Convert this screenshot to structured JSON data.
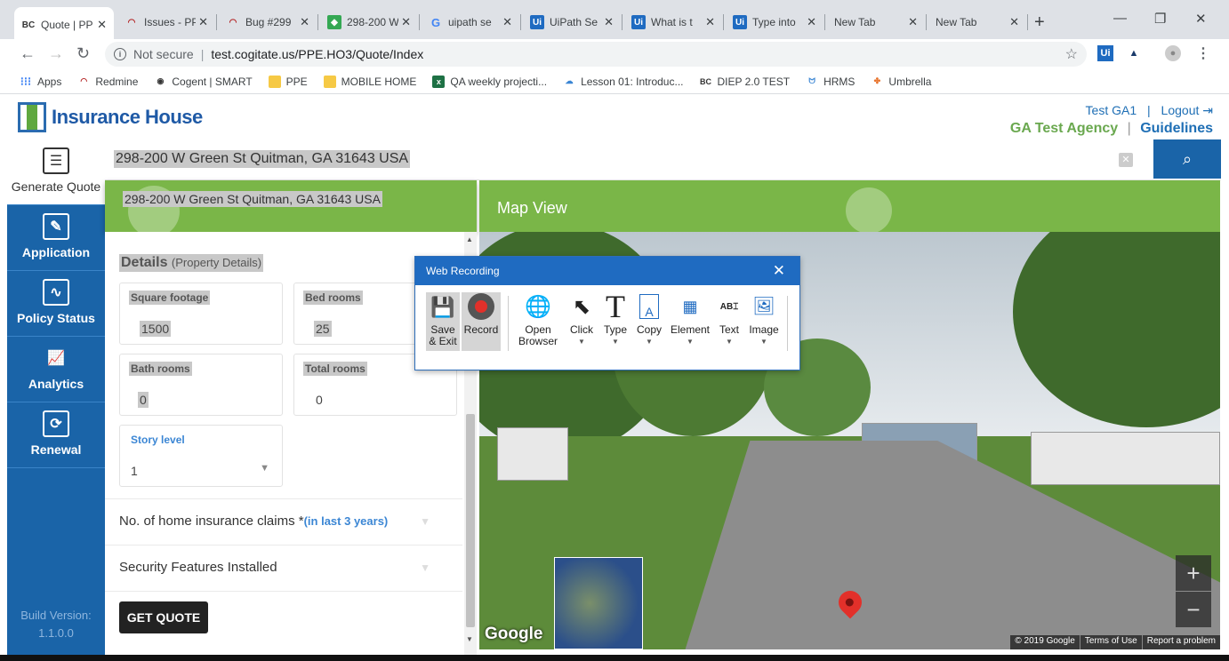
{
  "browser": {
    "tabs": [
      {
        "title": "Quote | PPE",
        "icon": "bc-icon"
      },
      {
        "title": "Issues - PPE",
        "icon": "redmine-icon"
      },
      {
        "title": "Bug #299",
        "icon": "redmine-icon"
      },
      {
        "title": "298-200 W",
        "icon": "maps-icon"
      },
      {
        "title": "uipath se",
        "icon": "google-icon"
      },
      {
        "title": "UiPath Se",
        "icon": "uipath-icon"
      },
      {
        "title": "What is t",
        "icon": "uipath-icon"
      },
      {
        "title": "Type into",
        "icon": "uipath-icon"
      },
      {
        "title": "New Tab",
        "icon": ""
      },
      {
        "title": "New Tab",
        "icon": ""
      }
    ],
    "not_secure": "Not secure",
    "url": "test.cogitate.us/PPE.HO3/Quote/Index",
    "bookmarks": [
      "Apps",
      "Redmine",
      "Cogent | SMART",
      "PPE",
      "MOBILE HOME",
      "QA weekly projecti...",
      "Lesson 01: Introduc...",
      "DIEP 2.0 TEST",
      "HRMS",
      "Umbrella"
    ]
  },
  "header": {
    "brand": "Insurance House",
    "user": "Test GA1",
    "logout": "Logout",
    "agency": "GA Test Agency",
    "guidelines": "Guidelines"
  },
  "sidebar": {
    "items": [
      {
        "label": "Generate Quote",
        "icon": "document-icon"
      },
      {
        "label": "Application",
        "icon": "edit-icon"
      },
      {
        "label": "Policy Status",
        "icon": "pulse-icon"
      },
      {
        "label": "Analytics",
        "icon": "chart-icon"
      },
      {
        "label": "Renewal",
        "icon": "renewal-icon"
      }
    ],
    "build_label": "Build Version:",
    "build_value": "1.1.0.0"
  },
  "search": {
    "value": "298-200 W Green St Quitman, GA 31643 USA"
  },
  "left_header": {
    "address": "298-200 W Green St Quitman, GA 31643 USA"
  },
  "map_header": {
    "title": "Map View"
  },
  "details": {
    "title": "Details",
    "subtitle": "(Property Details)",
    "fields": [
      {
        "label": "Square footage",
        "value": "1500"
      },
      {
        "label": "Bed rooms",
        "value": "25"
      },
      {
        "label": "Bath rooms",
        "value": "0"
      },
      {
        "label": "Total rooms",
        "value": "0"
      },
      {
        "label": "Story level",
        "value": "1"
      }
    ]
  },
  "accordions": {
    "claims": "No. of home insurance claims *",
    "claims_hint": "(in last 3 years)",
    "security": "Security Features Installed"
  },
  "get_quote": "GET QUOTE",
  "map": {
    "google": "Google",
    "footer": [
      "© 2019 Google",
      "Terms of Use",
      "Report a problem"
    ],
    "zoom_in": "+",
    "zoom_out": "−"
  },
  "recorder": {
    "title": "Web Recording",
    "buttons": [
      {
        "label": "Save\n& Exit",
        "icon": "save-icon"
      },
      {
        "label": "Record",
        "icon": "record-icon"
      },
      {
        "label": "Open\nBrowser",
        "icon": "globe-icon"
      },
      {
        "label": "Click",
        "icon": "cursor-icon"
      },
      {
        "label": "Type",
        "icon": "type-icon"
      },
      {
        "label": "Copy",
        "icon": "copy-icon"
      },
      {
        "label": "Element",
        "icon": "element-icon"
      },
      {
        "label": "Text",
        "icon": "text-icon"
      },
      {
        "label": "Image",
        "icon": "image-icon"
      }
    ]
  }
}
